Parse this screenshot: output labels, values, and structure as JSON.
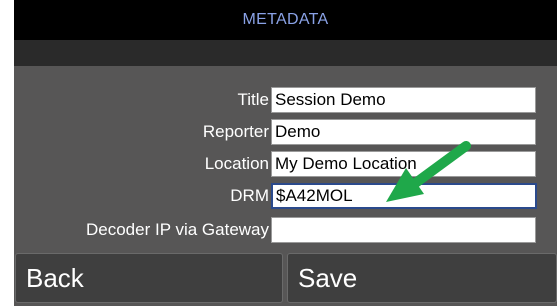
{
  "header": {
    "title": "METADATA"
  },
  "form": {
    "fields": [
      {
        "label": "Title",
        "value": "Session Demo"
      },
      {
        "label": "Reporter",
        "value": "Demo"
      },
      {
        "label": "Location",
        "value": "My Demo Location"
      },
      {
        "label": "DRM",
        "value": "$A42MOL"
      },
      {
        "label": "Decoder IP via Gateway",
        "value": ""
      }
    ]
  },
  "buttons": {
    "back_label": "Back",
    "save_label": "Save"
  },
  "colors": {
    "title_text": "#8aa2e6",
    "panel_bg": "#575656",
    "annotation_arrow": "#1fa84a"
  }
}
